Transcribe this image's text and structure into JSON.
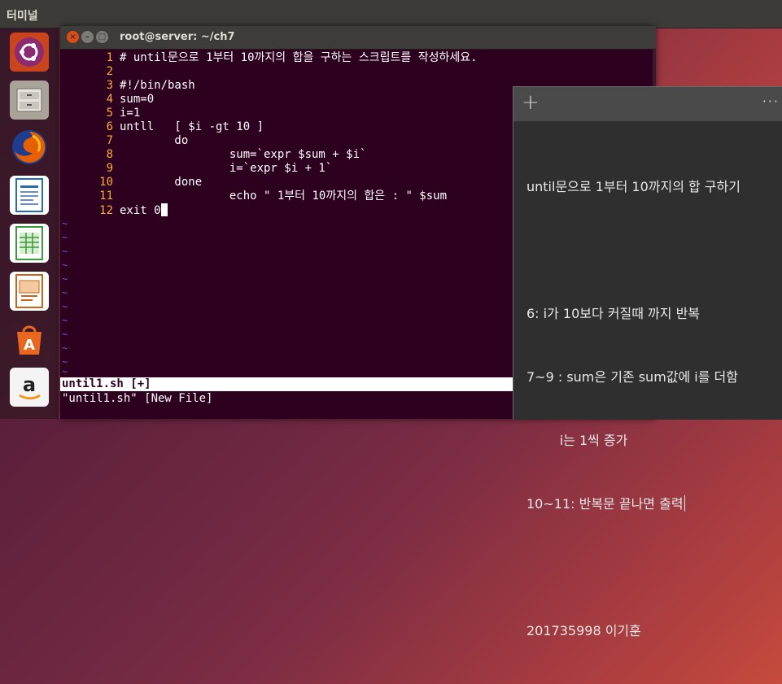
{
  "topbar": {
    "title": "터미널"
  },
  "launcher": {
    "items": [
      {
        "name": "ubuntu-dash-icon",
        "color": "#d44a21"
      },
      {
        "name": "file-manager-icon",
        "color": "#8a847a"
      },
      {
        "name": "firefox-icon",
        "color": "#e66000"
      },
      {
        "name": "libreoffice-writer-icon",
        "color": "#2a6bb5"
      },
      {
        "name": "libreoffice-calc-icon",
        "color": "#3b9a3a"
      },
      {
        "name": "libreoffice-impress-icon",
        "color": "#c8651b"
      },
      {
        "name": "software-center-icon",
        "color": "#e8681f"
      },
      {
        "name": "amazon-icon",
        "color": "#f0f0f0"
      }
    ]
  },
  "terminal": {
    "title": "root@server: ~/ch7",
    "lines": [
      {
        "num": "1",
        "text": "# until문으로 1부터 10까지의 합을 구하는 스크립트를 작성하세요."
      },
      {
        "num": "2",
        "text": ""
      },
      {
        "num": "3",
        "text": "#!/bin/bash"
      },
      {
        "num": "4",
        "text": "sum=0"
      },
      {
        "num": "5",
        "text": "i=1"
      },
      {
        "num": "6",
        "text": "untll   [ $i -gt 10 ]"
      },
      {
        "num": "7",
        "text": "        do"
      },
      {
        "num": "8",
        "text": "                sum=`expr $sum + $i`"
      },
      {
        "num": "9",
        "text": "                i=`expr $i + 1`"
      },
      {
        "num": "10",
        "text": "        done"
      },
      {
        "num": "11",
        "text": "                echo \" 1부터 10까지의 합은 : \" $sum"
      },
      {
        "num": "12",
        "text": "exit 0"
      }
    ],
    "tilde": "~",
    "status_line": "until1.sh [+]",
    "message_line": "\"until1.sh\" [New File]"
  },
  "note": {
    "plus": "+",
    "more": "···",
    "rows": [
      "until문으로 1부터 10까지의 합 구하기",
      "",
      "6: i가 10보다 커질때 까지 반복",
      "7~9 : sum은 기존 sum값에 i를 더함",
      "        i는 1씩 증가",
      "10~11: 반복문 끝나면 출력",
      "",
      "201735998 이기훈"
    ]
  }
}
